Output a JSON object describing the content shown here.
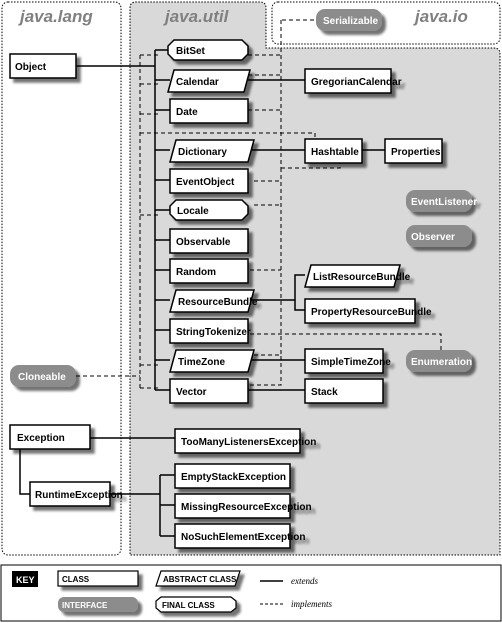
{
  "packages": {
    "java_lang": "java.lang",
    "java_util": "java.util",
    "java_io": "java.io"
  },
  "classes": {
    "object": "Object",
    "bitset": "BitSet",
    "calendar": "Calendar",
    "date": "Date",
    "dictionary": "Dictionary",
    "eventobject": "EventObject",
    "locale": "Locale",
    "observable": "Observable",
    "random": "Random",
    "resourcebundle": "ResourceBundle",
    "stringtokenizer": "StringTokenizer",
    "timezone": "TimeZone",
    "vector": "Vector",
    "gregoriancalendar": "GregorianCalendar",
    "hashtable": "Hashtable",
    "properties": "Properties",
    "listresourcebundle": "ListResourceBundle",
    "propertyresourcebundle": "PropertyResourceBundle",
    "simpletimezone": "SimpleTimeZone",
    "stack": "Stack",
    "exception": "Exception",
    "runtimeexception": "RuntimeException",
    "toomanylistenersexception": "TooManyListenersException",
    "emptystackexception": "EmptyStackException",
    "missingresourceexception": "MissingResourceException",
    "nosuchelementexception": "NoSuchElementException"
  },
  "interfaces": {
    "serializable": "Serializable",
    "eventlistener": "EventListener",
    "observer": "Observer",
    "enumeration": "Enumeration",
    "cloneable": "Cloneable"
  },
  "key": {
    "title": "KEY",
    "class": "CLASS",
    "abstract_class": "ABSTRACT CLASS",
    "interface": "INTERFACE",
    "final_class": "FINAL CLASS",
    "extends": "extends",
    "implements": "implements"
  },
  "colors": {
    "util_bg": "#d9d9d9",
    "interface_fill": "#8c8c8c",
    "title_gray": "#808080",
    "shadow": "#6e6e6e"
  }
}
